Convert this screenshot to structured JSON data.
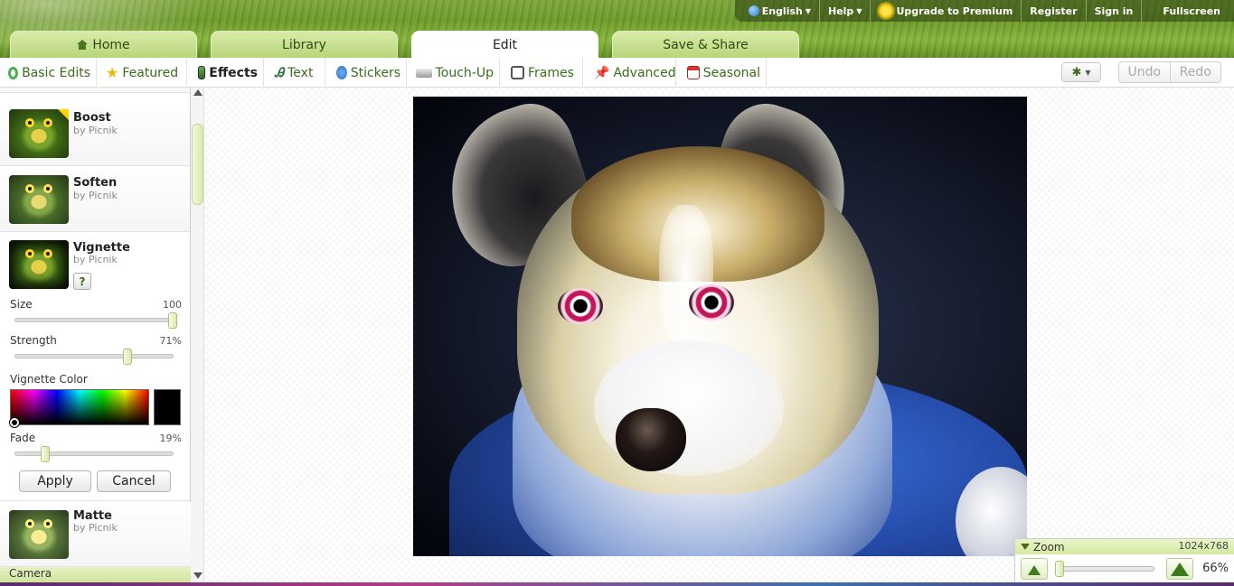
{
  "header": {
    "top_links": [
      "English",
      "Help",
      "Upgrade to Premium",
      "Register",
      "Sign in",
      "Fullscreen"
    ],
    "tabs": [
      {
        "label": "Home",
        "active": false
      },
      {
        "label": "Library",
        "active": false
      },
      {
        "label": "Edit",
        "active": true
      },
      {
        "label": "Save & Share",
        "active": false
      }
    ]
  },
  "toolbar": {
    "items": [
      {
        "label": "Basic Edits",
        "icon": "recycle-arrows-icon"
      },
      {
        "label": "Featured",
        "icon": "star-icon"
      },
      {
        "label": "Effects",
        "icon": "effects-film-icon",
        "active": true
      },
      {
        "label": "Text",
        "icon": "text-letters-icon"
      },
      {
        "label": "Stickers",
        "icon": "smiley-icon"
      },
      {
        "label": "Touch-Up",
        "icon": "lipstick-icon"
      },
      {
        "label": "Frames",
        "icon": "frame-icon"
      },
      {
        "label": "Advanced",
        "icon": "pushpin-icon"
      },
      {
        "label": "Seasonal",
        "icon": "calendar-icon"
      }
    ],
    "undo": "Undo",
    "redo": "Redo"
  },
  "sidebar": {
    "effects": [
      {
        "name": "Boost",
        "by": "by Picnik",
        "premium": true
      },
      {
        "name": "Soften",
        "by": "by Picnik"
      },
      {
        "name": "Vignette",
        "by": "by Picnik",
        "expanded": true
      },
      {
        "name": "Matte",
        "by": "by Picnik"
      }
    ],
    "vignette": {
      "help": "?",
      "size_label": "Size",
      "size_value": "100",
      "size_fraction": 1.0,
      "strength_label": "Strength",
      "strength_value": "71%",
      "strength_fraction": 0.71,
      "color_label": "Vignette Color",
      "color_value": "#000000",
      "fade_label": "Fade",
      "fade_value": "19%",
      "fade_fraction": 0.19,
      "apply": "Apply",
      "cancel": "Cancel"
    },
    "next_category": "Camera"
  },
  "zoom": {
    "label": "Zoom",
    "dimensions": "1024x768",
    "percent": "66%",
    "level_fraction": 0.0
  }
}
